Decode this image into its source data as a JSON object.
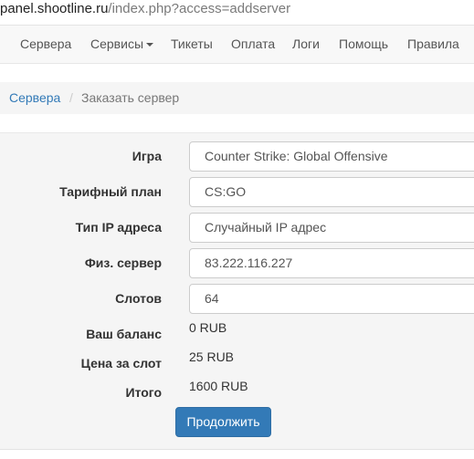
{
  "browser": {
    "url_host": "panel.shootline.ru",
    "url_path": "/index.php?access=addserver"
  },
  "nav": {
    "items": [
      {
        "label": "Сервера"
      },
      {
        "label": "Сервисы",
        "dropdown": true
      },
      {
        "label": "Тикеты"
      },
      {
        "label": "Оплата"
      },
      {
        "label": "Логи"
      },
      {
        "label": "Помощь"
      },
      {
        "label": "Правила"
      }
    ]
  },
  "breadcrumb": {
    "link": "Сервера",
    "separator": "/",
    "current": "Заказать сервер"
  },
  "form": {
    "game": {
      "label": "Игра",
      "value": "Counter Strike: Global Offensive"
    },
    "tariff": {
      "label": "Тарифный план",
      "value": "CS:GO"
    },
    "ip_type": {
      "label": "Тип IP адреса",
      "value": "Случайный IP адрес"
    },
    "server": {
      "label": "Физ. сервер",
      "value": "83.222.116.227"
    },
    "slots": {
      "label": "Слотов",
      "value": "64"
    },
    "balance": {
      "label": "Ваш баланс",
      "value": "0 RUB"
    },
    "price_per_slot": {
      "label": "Цена за слот",
      "value": "25 RUB"
    },
    "total": {
      "label": "Итого",
      "value": "1600 RUB"
    },
    "submit_label": "Продолжить"
  },
  "colors": {
    "primary": "#337ab7",
    "link": "#337ab7",
    "navbar_bg": "#f8f8f8",
    "panel_bg": "#f5f5f5"
  }
}
